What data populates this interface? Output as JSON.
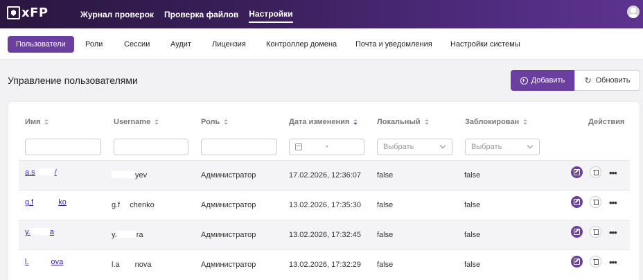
{
  "app": {
    "logo_text": "xFP"
  },
  "topnav": {
    "items": [
      "Журнал проверок",
      "Проверка файлов",
      "Настройки"
    ]
  },
  "subnav": {
    "tabs": [
      "Пользователи",
      "Роли",
      "Сессии",
      "Аудит",
      "Лицензия",
      "Контроллер домена",
      "Почта и уведомления",
      "Настройки системы"
    ]
  },
  "page": {
    "title": "Управление пользователями",
    "add_label": "Добавить",
    "refresh_label": "Обновить"
  },
  "table": {
    "headers": [
      "Имя",
      "Username",
      "Роль",
      "Дата изменения",
      "Локальный",
      "Заблокирован",
      "Действия"
    ],
    "filters": {
      "date_separator": "-",
      "select_placeholder": "Выбрать"
    },
    "rows": [
      {
        "name_start": "a.s",
        "name_end": "/",
        "username_start": "",
        "username_end": "yev",
        "role": "Администратор",
        "date": "17.02.2026, 12:36:07",
        "local": "false",
        "blocked": "false"
      },
      {
        "name_start": "g.f",
        "name_end": "ko",
        "username_start": "g.f",
        "username_end": "chenko",
        "role": "Администратор",
        "date": "13.02.2026, 17:35:30",
        "local": "false",
        "blocked": "false"
      },
      {
        "name_start": "y.",
        "name_end": "a",
        "username_start": "y.",
        "username_end": "ra",
        "role": "Администратор",
        "date": "13.02.2026, 17:32:45",
        "local": "false",
        "blocked": "false"
      },
      {
        "name_start": "l.",
        "name_end": "ova",
        "username_start": "l.a",
        "username_end": "nova",
        "role": "Администратор",
        "date": "13.02.2026, 17:32:29",
        "local": "false",
        "blocked": "false"
      }
    ]
  },
  "colors": {
    "accent": "#6b3fa0",
    "topbar_dark": "#2a1640",
    "topbar_light": "#5d3390",
    "link": "#3a1fb0"
  },
  "icons": [
    "logo-shield-icon",
    "avatar-icon",
    "plus-circle-icon",
    "refresh-icon",
    "sort-icon",
    "calendar-icon",
    "chevron-down-icon",
    "edit-icon",
    "delete-icon",
    "more-icon"
  ]
}
